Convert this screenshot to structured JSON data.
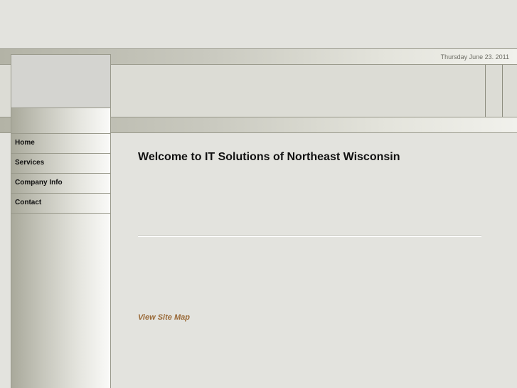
{
  "header": {
    "date": "Thursday June 23. 2011"
  },
  "nav": {
    "items": [
      {
        "label": "Home"
      },
      {
        "label": "Services"
      },
      {
        "label": "Company Info"
      },
      {
        "label": "Contact"
      }
    ]
  },
  "main": {
    "title": "Welcome to IT Solutions of Northeast Wisconsin",
    "sitemap_link": "View Site Map"
  },
  "colors": {
    "background": "#e3e3de",
    "link": "#9a6a38"
  }
}
